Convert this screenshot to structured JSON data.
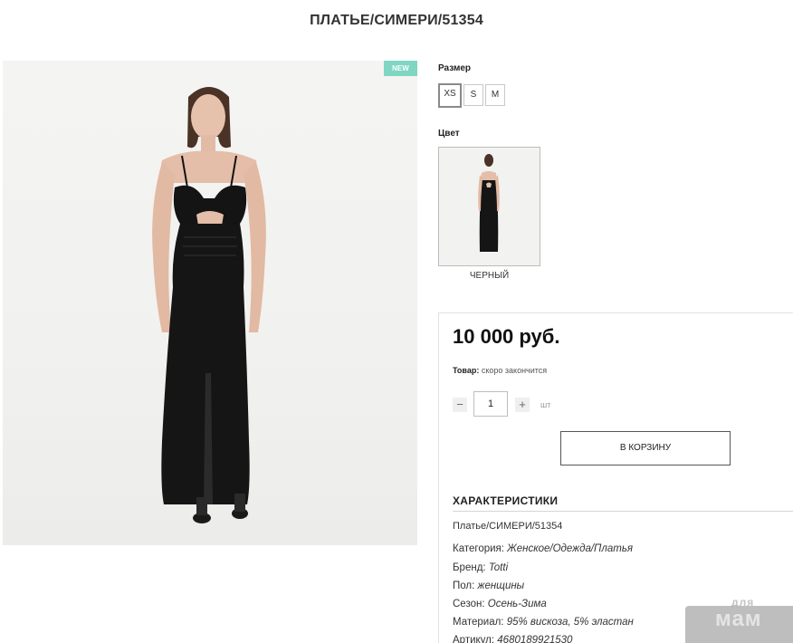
{
  "page_title": "ПЛАТЬЕ/СИМЕРИ/51354",
  "badge": "NEW",
  "size": {
    "label": "Размер",
    "options": [
      "XS",
      "S",
      "M"
    ],
    "selected": "XS"
  },
  "color": {
    "label": "Цвет",
    "name": "ЧЕРНЫЙ"
  },
  "price": "10 000 руб.",
  "stock": {
    "label": "Товар:",
    "value": "скоро закончится"
  },
  "quantity": {
    "minus": "−",
    "value": "1",
    "plus": "+",
    "unit": "шт"
  },
  "cart_button": "В КОРЗИНУ",
  "specs": {
    "title": "ХАРАКТЕРИСТИКИ",
    "product_name": "Платье/СИМЕРИ/51354",
    "rows": [
      {
        "key": "Категория:",
        "value": "Женское/Одежда/Платья"
      },
      {
        "key": "Бренд:",
        "value": "Totti"
      },
      {
        "key": "Пол:",
        "value": "женщины"
      },
      {
        "key": "Сезон:",
        "value": "Осень-Зима"
      },
      {
        "key": "Материал:",
        "value": "95% вискоза, 5% эластан"
      },
      {
        "key": "Артикул:",
        "value": "4680189921530"
      }
    ]
  },
  "watermark": {
    "small": "для",
    "big": "мам"
  }
}
